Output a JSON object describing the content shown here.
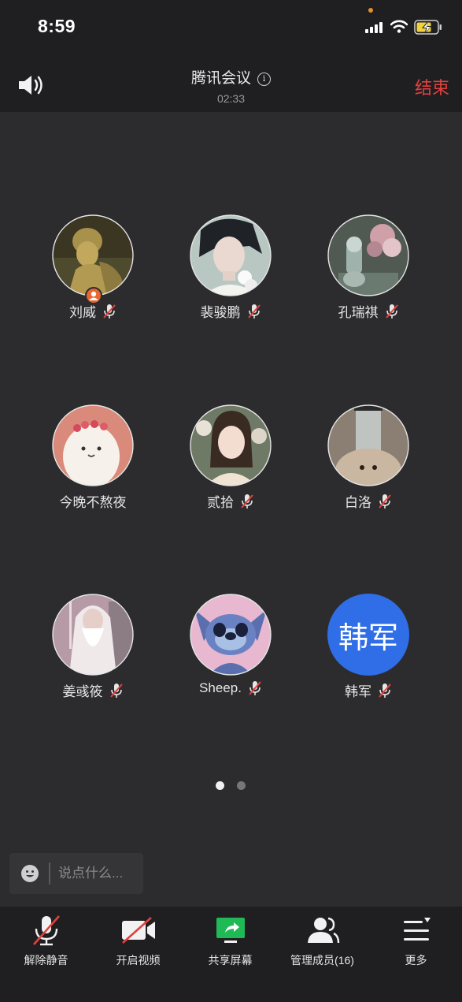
{
  "status_bar": {
    "time": "8:59",
    "icons": [
      "signal-icon",
      "wifi-icon",
      "battery-charging-icon"
    ]
  },
  "header": {
    "title": "腾讯会议",
    "duration": "02:33",
    "end_label": "结束"
  },
  "participants": [
    {
      "name": "刘威",
      "muted": true,
      "host": true
    },
    {
      "name": "裴骏鹏",
      "muted": true,
      "host": false
    },
    {
      "name": "孔瑞祺",
      "muted": true,
      "host": false
    },
    {
      "name": "今晚不熬夜",
      "muted": false,
      "host": false
    },
    {
      "name": "贰拾",
      "muted": true,
      "host": false
    },
    {
      "name": "白洛",
      "muted": true,
      "host": false
    },
    {
      "name": "姜彧筱",
      "muted": true,
      "host": false
    },
    {
      "name": "Sheep.",
      "muted": true,
      "host": false
    },
    {
      "name": "韩军",
      "muted": true,
      "host": false,
      "avatar_text": "韩军"
    }
  ],
  "pager": {
    "pages": 2,
    "current": 1
  },
  "chat": {
    "placeholder": "说点什么..."
  },
  "toolbar": {
    "unmute": "解除静音",
    "video": "开启视频",
    "share": "共享屏幕",
    "manage": "管理成员(16)",
    "more": "更多"
  },
  "colors": {
    "accent_end": "#e0423f",
    "share_green": "#1fb955",
    "avatar_blue": "#2f6ee7",
    "mute_red": "#e0423f",
    "host_orange": "#e8662f"
  }
}
